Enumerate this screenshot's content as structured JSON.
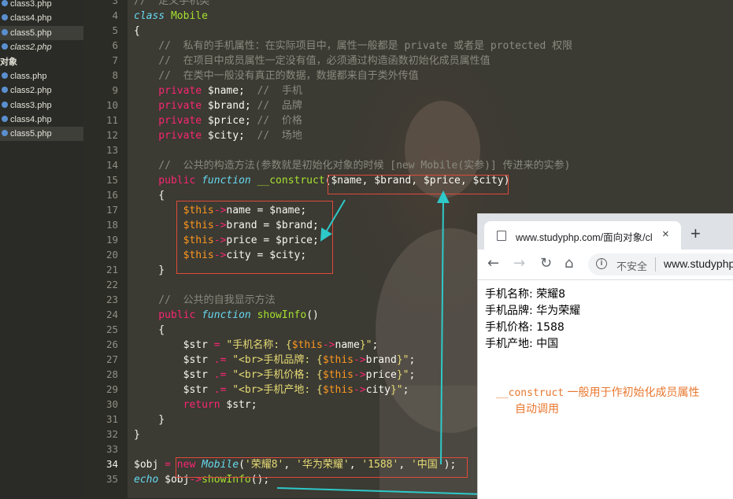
{
  "sidebar": {
    "items": [
      {
        "label": "class3.php",
        "type": "file"
      },
      {
        "label": "class4.php",
        "type": "file"
      },
      {
        "label": "class5.php",
        "type": "file",
        "selected": true
      },
      {
        "label": "class2.php",
        "type": "file",
        "italic": true
      },
      {
        "label": "对象",
        "type": "folder"
      },
      {
        "label": "class.php",
        "type": "file"
      },
      {
        "label": "class2.php",
        "type": "file"
      },
      {
        "label": "class3.php",
        "type": "file"
      },
      {
        "label": "class4.php",
        "type": "file"
      },
      {
        "label": "class5.php",
        "type": "file",
        "selected": true
      }
    ]
  },
  "editor": {
    "current_line": "34",
    "line_numbers": [
      "3",
      "4",
      "5",
      "6",
      "7",
      "8",
      "9",
      "10",
      "11",
      "12",
      "13",
      "14",
      "15",
      "16",
      "17",
      "18",
      "19",
      "20",
      "21",
      "22",
      "23",
      "24",
      "25",
      "26",
      "27",
      "28",
      "29",
      "30",
      "31",
      "32",
      "33",
      "34",
      "35"
    ],
    "lines": [
      {
        "n": "3",
        "tokens": [
          {
            "t": "//  定义手机类",
            "c": "cm"
          }
        ]
      },
      {
        "n": "4",
        "tokens": [
          {
            "t": "class",
            "c": "kwi"
          },
          {
            "t": " ",
            "c": "vr"
          },
          {
            "t": "Mobile",
            "c": "fn"
          }
        ]
      },
      {
        "n": "5",
        "tokens": [
          {
            "t": "{",
            "c": "br"
          }
        ]
      },
      {
        "n": "6",
        "tokens": [
          {
            "t": "    //  私有的手机属性：在实际项目中，属性一般都是 private 或者是 protected 权限",
            "c": "cm"
          }
        ]
      },
      {
        "n": "7",
        "tokens": [
          {
            "t": "    //  在项目中成员属性一定没有值，必须通过构造函数初始化成员属性值",
            "c": "cm"
          }
        ]
      },
      {
        "n": "8",
        "tokens": [
          {
            "t": "    //  在类中一般没有真正的数据，数据都来自于类外传值",
            "c": "cm"
          }
        ]
      },
      {
        "n": "9",
        "tokens": [
          {
            "t": "    private",
            "c": "kw"
          },
          {
            "t": " $name;",
            "c": "vr"
          },
          {
            "t": "  //  手机",
            "c": "cm"
          }
        ]
      },
      {
        "n": "10",
        "tokens": [
          {
            "t": "    private",
            "c": "kw"
          },
          {
            "t": " $brand;",
            "c": "vr"
          },
          {
            "t": " //  品牌",
            "c": "cm"
          }
        ]
      },
      {
        "n": "11",
        "tokens": [
          {
            "t": "    private",
            "c": "kw"
          },
          {
            "t": " $price;",
            "c": "vr"
          },
          {
            "t": " //  价格",
            "c": "cm"
          }
        ]
      },
      {
        "n": "12",
        "tokens": [
          {
            "t": "    private",
            "c": "kw"
          },
          {
            "t": " $city;",
            "c": "vr"
          },
          {
            "t": "  //  场地",
            "c": "cm"
          }
        ]
      },
      {
        "n": "13",
        "tokens": []
      },
      {
        "n": "14",
        "tokens": [
          {
            "t": "    //  公共的构造方法(参数就是初始化对象的时候 [new Mobile(实参)] 传进来的实参)",
            "c": "cm"
          }
        ]
      },
      {
        "n": "15",
        "tokens": [
          {
            "t": "    public",
            "c": "kw"
          },
          {
            "t": " ",
            "c": "vr"
          },
          {
            "t": "function",
            "c": "kwi"
          },
          {
            "t": " ",
            "c": "vr"
          },
          {
            "t": "__construct",
            "c": "fn"
          },
          {
            "t": "($name, $brand, $price, $city)",
            "c": "vr"
          }
        ]
      },
      {
        "n": "16",
        "tokens": [
          {
            "t": "    {",
            "c": "br"
          }
        ]
      },
      {
        "n": "17",
        "tokens": [
          {
            "t": "        $this",
            "c": "th"
          },
          {
            "t": "->",
            "c": "kw"
          },
          {
            "t": "name = $name;",
            "c": "vr"
          }
        ]
      },
      {
        "n": "18",
        "tokens": [
          {
            "t": "        $this",
            "c": "th"
          },
          {
            "t": "->",
            "c": "kw"
          },
          {
            "t": "brand = $brand;",
            "c": "vr"
          }
        ]
      },
      {
        "n": "19",
        "tokens": [
          {
            "t": "        $this",
            "c": "th"
          },
          {
            "t": "->",
            "c": "kw"
          },
          {
            "t": "price = $price;",
            "c": "vr"
          }
        ]
      },
      {
        "n": "20",
        "tokens": [
          {
            "t": "        $this",
            "c": "th"
          },
          {
            "t": "->",
            "c": "kw"
          },
          {
            "t": "city = $city;",
            "c": "vr"
          }
        ]
      },
      {
        "n": "21",
        "tokens": [
          {
            "t": "    }",
            "c": "br"
          }
        ]
      },
      {
        "n": "22",
        "tokens": []
      },
      {
        "n": "23",
        "tokens": [
          {
            "t": "    //  公共的自我显示方法",
            "c": "cm"
          }
        ]
      },
      {
        "n": "24",
        "tokens": [
          {
            "t": "    public",
            "c": "kw"
          },
          {
            "t": " ",
            "c": "vr"
          },
          {
            "t": "function",
            "c": "kwi"
          },
          {
            "t": " ",
            "c": "vr"
          },
          {
            "t": "showInfo",
            "c": "fn"
          },
          {
            "t": "()",
            "c": "vr"
          }
        ]
      },
      {
        "n": "25",
        "tokens": [
          {
            "t": "    {",
            "c": "br"
          }
        ]
      },
      {
        "n": "26",
        "tokens": [
          {
            "t": "        $str ",
            "c": "vr"
          },
          {
            "t": "=",
            "c": "kw"
          },
          {
            "t": " \"手机名称: {",
            "c": "st"
          },
          {
            "t": "$this",
            "c": "th"
          },
          {
            "t": "->",
            "c": "kw"
          },
          {
            "t": "name",
            "c": "vr"
          },
          {
            "t": "}\"",
            "c": "st"
          },
          {
            "t": ";",
            "c": "vr"
          }
        ]
      },
      {
        "n": "27",
        "tokens": [
          {
            "t": "        $str ",
            "c": "vr"
          },
          {
            "t": ".=",
            "c": "kw"
          },
          {
            "t": " \"<br>手机品牌: {",
            "c": "st"
          },
          {
            "t": "$this",
            "c": "th"
          },
          {
            "t": "->",
            "c": "kw"
          },
          {
            "t": "brand",
            "c": "vr"
          },
          {
            "t": "}\"",
            "c": "st"
          },
          {
            "t": ";",
            "c": "vr"
          }
        ]
      },
      {
        "n": "28",
        "tokens": [
          {
            "t": "        $str ",
            "c": "vr"
          },
          {
            "t": ".=",
            "c": "kw"
          },
          {
            "t": " \"<br>手机价格: {",
            "c": "st"
          },
          {
            "t": "$this",
            "c": "th"
          },
          {
            "t": "->",
            "c": "kw"
          },
          {
            "t": "price",
            "c": "vr"
          },
          {
            "t": "}\"",
            "c": "st"
          },
          {
            "t": ";",
            "c": "vr"
          }
        ]
      },
      {
        "n": "29",
        "tokens": [
          {
            "t": "        $str ",
            "c": "vr"
          },
          {
            "t": ".=",
            "c": "kw"
          },
          {
            "t": " \"<br>手机产地: {",
            "c": "st"
          },
          {
            "t": "$this",
            "c": "th"
          },
          {
            "t": "->",
            "c": "kw"
          },
          {
            "t": "city",
            "c": "vr"
          },
          {
            "t": "}\"",
            "c": "st"
          },
          {
            "t": ";",
            "c": "vr"
          }
        ]
      },
      {
        "n": "30",
        "tokens": [
          {
            "t": "        return",
            "c": "kw"
          },
          {
            "t": " $str;",
            "c": "vr"
          }
        ]
      },
      {
        "n": "31",
        "tokens": [
          {
            "t": "    }",
            "c": "br"
          }
        ]
      },
      {
        "n": "32",
        "tokens": [
          {
            "t": "}",
            "c": "br"
          }
        ]
      },
      {
        "n": "33",
        "tokens": []
      },
      {
        "n": "34",
        "tokens": [
          {
            "t": "$obj ",
            "c": "vr"
          },
          {
            "t": "=",
            "c": "kw"
          },
          {
            "t": " ",
            "c": "vr"
          },
          {
            "t": "new",
            "c": "kw"
          },
          {
            "t": " ",
            "c": "vr"
          },
          {
            "t": "Mobile",
            "c": "kwi"
          },
          {
            "t": "(",
            "c": "vr"
          },
          {
            "t": "'荣耀8'",
            "c": "st"
          },
          {
            "t": ", ",
            "c": "vr"
          },
          {
            "t": "'华为荣耀'",
            "c": "st"
          },
          {
            "t": ", ",
            "c": "vr"
          },
          {
            "t": "'1588'",
            "c": "st"
          },
          {
            "t": ", ",
            "c": "vr"
          },
          {
            "t": "'中国'",
            "c": "st"
          },
          {
            "t": ");",
            "c": "vr"
          }
        ]
      },
      {
        "n": "35",
        "tokens": [
          {
            "t": "echo",
            "c": "kwi"
          },
          {
            "t": " $obj",
            "c": "vr"
          },
          {
            "t": "->",
            "c": "kw"
          },
          {
            "t": "showInfo",
            "c": "fn"
          },
          {
            "t": "();",
            "c": "vr"
          }
        ]
      }
    ]
  },
  "browser": {
    "tab_title": "www.studyphp.com/面向对象/cl",
    "tab_close": "×",
    "new_tab": "+",
    "back_icon": "arrow-left",
    "forward_icon": "arrow-right",
    "reload_icon": "reload",
    "home_icon": "home",
    "security_label": "不安全",
    "url": "www.studyphp",
    "output": [
      "手机名称: 荣耀8",
      "手机品牌: 华为荣耀",
      "手机价格: 1588",
      "手机产地: 中国"
    ]
  },
  "annotation": {
    "code": "__construct",
    "text1": " 一般用于作初始化成员属性",
    "text2": "自动调用",
    "color": "#e8772e"
  },
  "colors": {
    "box": "#e04a3a",
    "arrow": "#2ec9c9"
  }
}
